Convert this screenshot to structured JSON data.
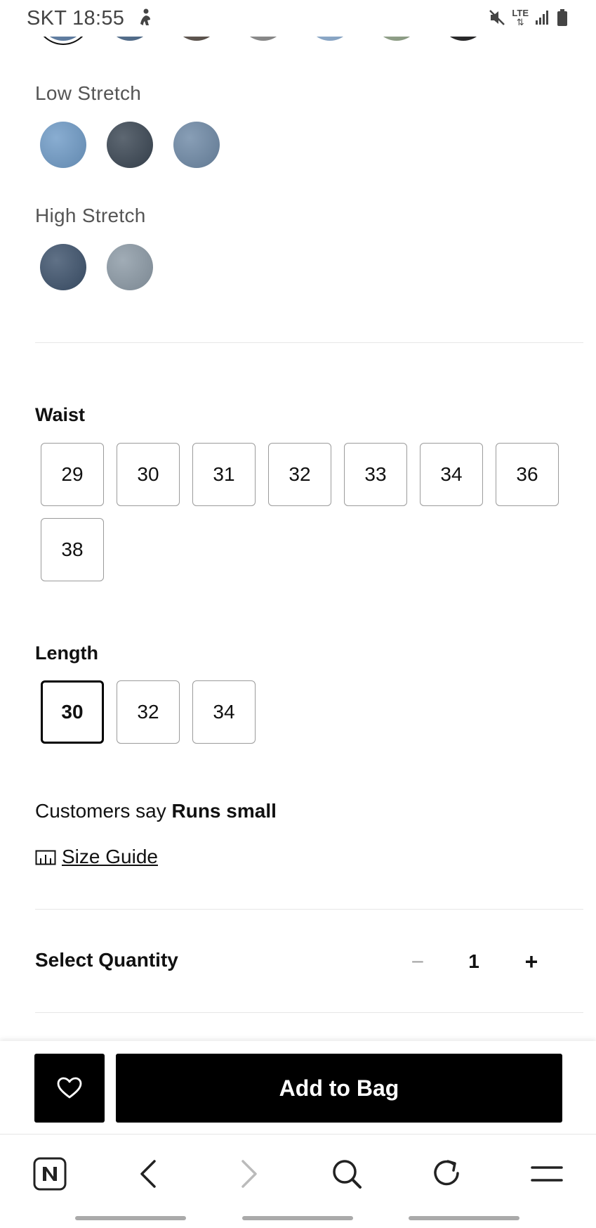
{
  "status_bar": {
    "time": "SKT 18:55",
    "network": "LTE"
  },
  "colors": {
    "top_row": [
      "#5d7fa8",
      "#4e6c8e",
      "#5a5049",
      "#8c8c8c",
      "#8eafd3",
      "#93a58a",
      "#1d1d1f"
    ],
    "low_stretch": [
      "#6f9bc7",
      "#3a4653",
      "#6e89a6"
    ],
    "high_stretch": [
      "#3d526c",
      "#8c9aa6"
    ],
    "accent": "#000000"
  },
  "stretch": {
    "low_label": "Low Stretch",
    "high_label": "High Stretch"
  },
  "waist": {
    "title": "Waist",
    "sizes": [
      "29",
      "30",
      "31",
      "32",
      "33",
      "34",
      "36",
      "38"
    ]
  },
  "length": {
    "title": "Length",
    "sizes": [
      "30",
      "32",
      "34"
    ],
    "selected": "30"
  },
  "fit": {
    "prefix": "Customers say",
    "value": "Runs small"
  },
  "size_guide": {
    "label": "Size Guide",
    "icon": "ruler-icon"
  },
  "quantity": {
    "label": "Select Quantity",
    "minus": "−",
    "value": "1",
    "plus": "+"
  },
  "actions": {
    "wishlist_icon": "heart-icon",
    "add_label": "Add to Bag"
  },
  "browser": {
    "icons": [
      "naver-home-icon",
      "back-icon",
      "forward-icon",
      "search-icon",
      "refresh-icon",
      "menu-icon"
    ]
  }
}
